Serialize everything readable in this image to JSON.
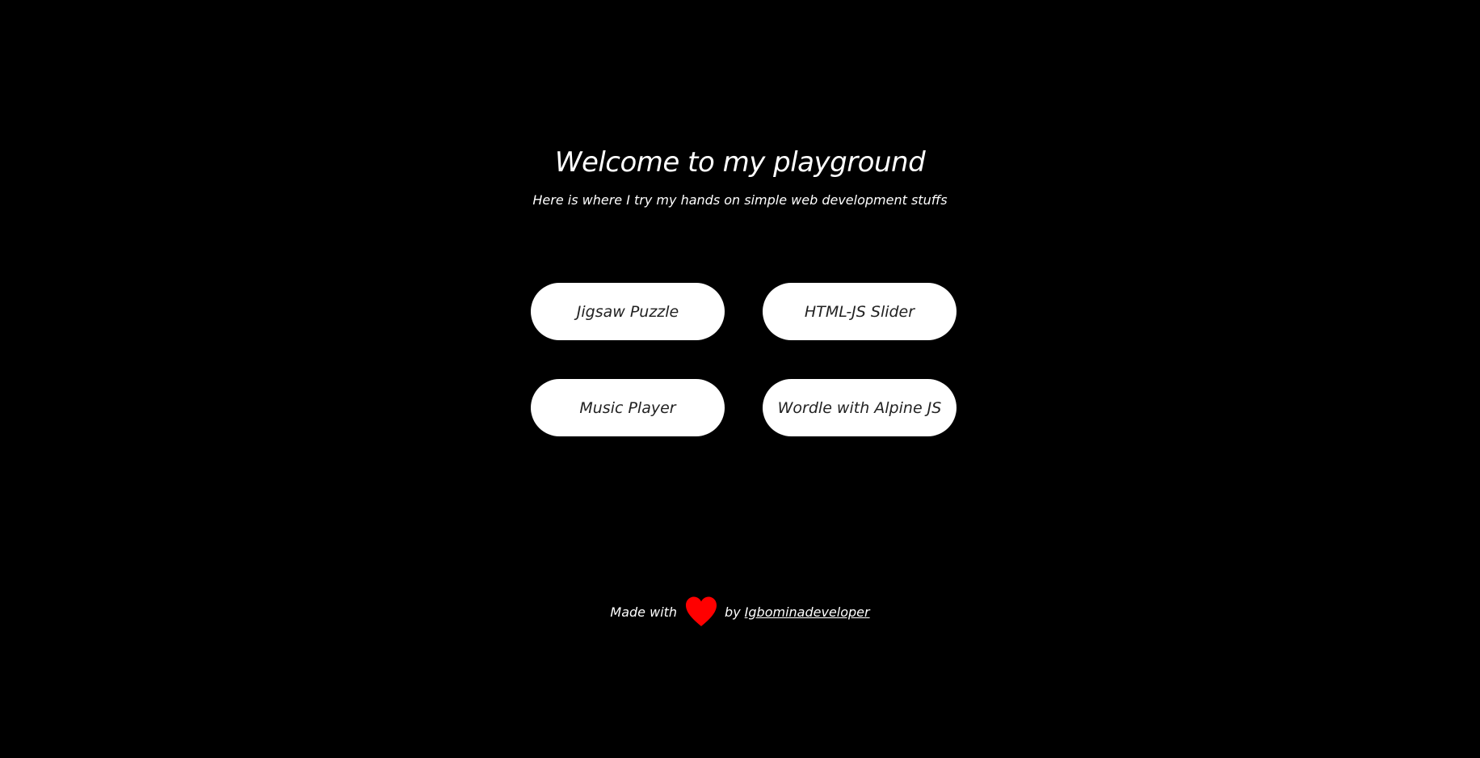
{
  "hero": {
    "title": "Welcome to my playground",
    "subtitle": "Here is where I try my hands on simple web development stuffs"
  },
  "projects": [
    {
      "label": "Jigsaw Puzzle"
    },
    {
      "label": "HTML-JS Slider"
    },
    {
      "label": "Music Player"
    },
    {
      "label": "Wordle with Alpine JS"
    }
  ],
  "footer": {
    "made_with": "Made with",
    "heart_icon": "heart-icon",
    "heart_color": "#ff0000",
    "by": "by",
    "author": "Igbominadeveloper"
  },
  "colors": {
    "background": "#000000",
    "button_background": "#ffffff",
    "button_text": "#222222",
    "text": "#ffffff"
  }
}
